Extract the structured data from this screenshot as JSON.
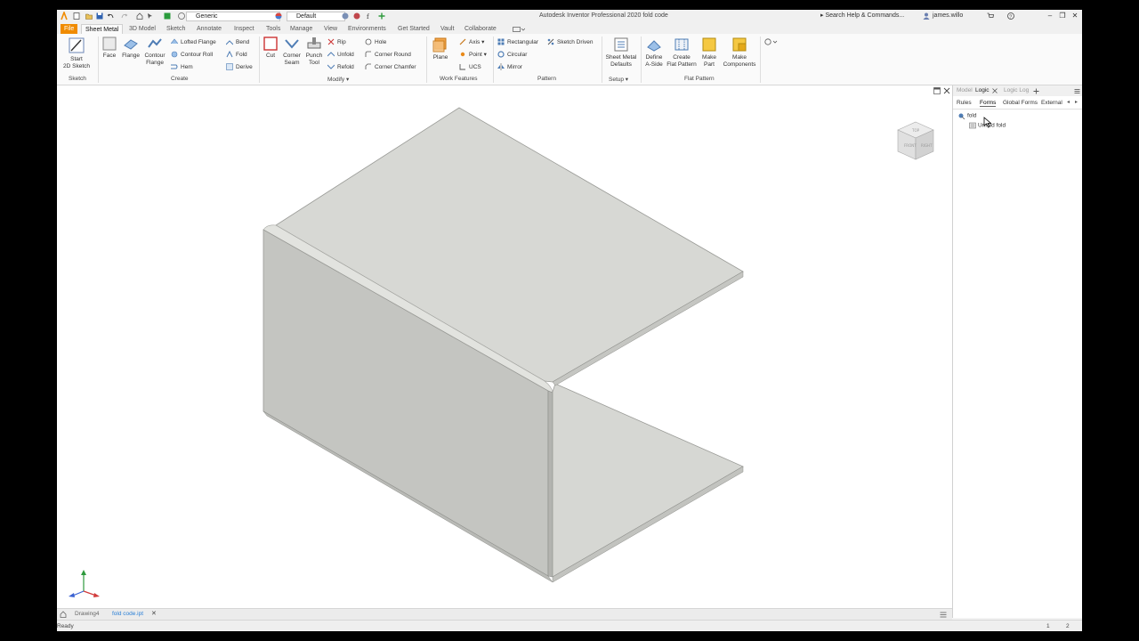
{
  "quick_access": {
    "material": "Generic",
    "appearance": "Default"
  },
  "window": {
    "title": "Autodesk Inventor Professional 2020   fold code",
    "search_placeholder": "Search Help & Commands...",
    "user": "james.willo"
  },
  "tabs": [
    "File",
    "Sheet Metal",
    "3D Model",
    "Sketch",
    "Annotate",
    "Inspect",
    "Tools",
    "Manage",
    "View",
    "Environments",
    "Get Started",
    "Vault",
    "Collaborate"
  ],
  "ribbon": {
    "sketch": {
      "start_sketch": "Start\n2D Sketch",
      "panel": "Sketch"
    },
    "create": {
      "face": "Face",
      "flange": "Flange",
      "contour_flange": "Contour\nFlange",
      "lofted_flange": "Lofted Flange",
      "contour_roll": "Contour Roll",
      "hem": "Hem",
      "bend": "Bend",
      "fold": "Fold",
      "derive": "Derive",
      "panel": "Create"
    },
    "modify": {
      "cut": "Cut",
      "corner_seam": "Corner\nSeam",
      "punch_tool": "Punch\nTool",
      "rip": "Rip",
      "unfold": "Unfold",
      "refold": "Refold",
      "hole": "Hole",
      "corner_round": "Corner Round",
      "corner_chamfer": "Corner Chamfer",
      "panel": "Modify ▾"
    },
    "work_features": {
      "plane": "Plane",
      "axis": "Axis",
      "point": "Point",
      "ucs": "UCS",
      "panel": "Work Features"
    },
    "pattern": {
      "rectangular": "Rectangular",
      "circular": "Circular",
      "mirror": "Mirror",
      "sketch_driven": "Sketch Driven",
      "panel": "Pattern"
    },
    "setup": {
      "defaults": "Sheet Metal\nDefaults",
      "panel": "Setup ▾"
    },
    "flat_pattern": {
      "define_aside": "Define\nA-Side",
      "create_flat": "Create\nFlat Pattern",
      "make_part": "Make\nPart",
      "make_components": "Make\nComponents",
      "panel": "Flat Pattern"
    }
  },
  "browser": {
    "tabs": [
      "Model",
      "Logic",
      "Logic Log"
    ],
    "active_tab": "Logic",
    "sub_tabs": [
      "Rules",
      "Forms",
      "Global Forms",
      "External"
    ],
    "tree": [
      "fold",
      "Unfold fold"
    ]
  },
  "view_cube": {
    "front": "FRONT",
    "right": "RIGHT",
    "top": "TOP"
  },
  "documents": [
    "Drawing4",
    "fold code.ipt"
  ],
  "status": {
    "text": "Ready",
    "page1": "1",
    "page2": "2"
  },
  "colors": {
    "file_tab": "#f08b00",
    "active_doc": "#2a7fd6",
    "model_face": "#d8d9d5"
  }
}
